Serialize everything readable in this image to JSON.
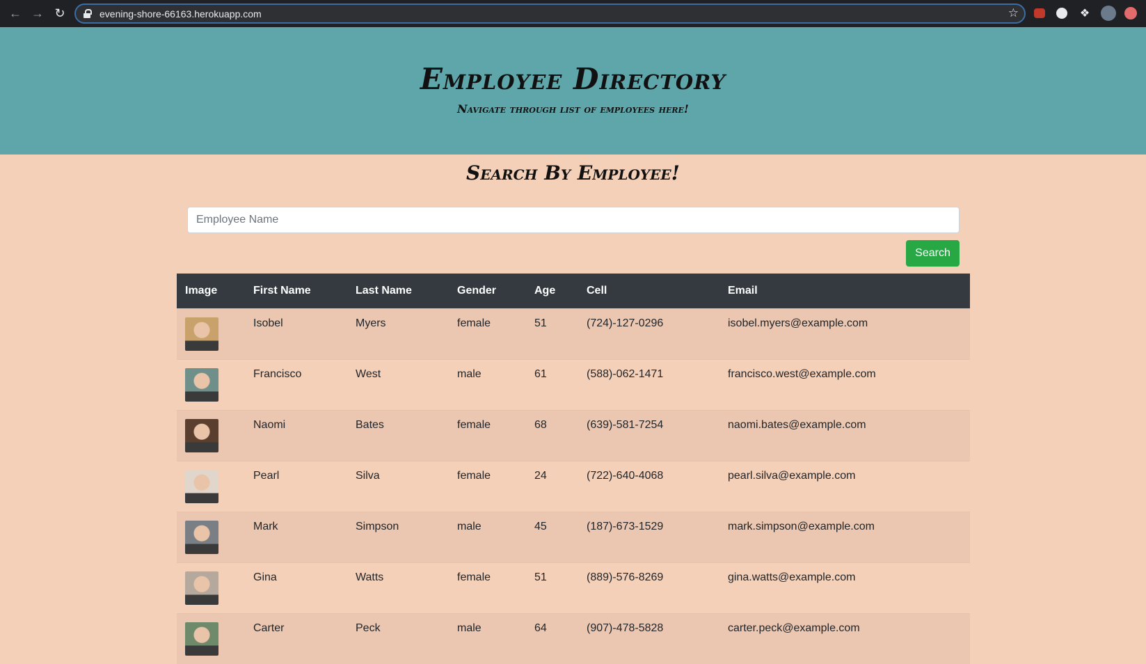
{
  "browser": {
    "url": "evening-shore-66163.herokuapp.com",
    "nav_back_icon": "arrow-left-icon",
    "nav_forward_icon": "arrow-right-icon",
    "reload_icon": "reload-icon",
    "star_icon": "star-icon"
  },
  "header": {
    "title": "Employee Directory",
    "subtitle": "Navigate through list of employees here!"
  },
  "search": {
    "heading": "Search By Employee!",
    "placeholder": "Employee Name",
    "value": "",
    "button_label": "Search"
  },
  "table": {
    "columns": [
      "Image",
      "First Name",
      "Last Name",
      "Gender",
      "Age",
      "Cell",
      "Email"
    ],
    "rows": [
      {
        "first": "Isobel",
        "last": "Myers",
        "gender": "female",
        "age": "51",
        "cell": "(724)-127-0296",
        "email": "isobel.myers@example.com",
        "avatar_color": "#c9a16a"
      },
      {
        "first": "Francisco",
        "last": "West",
        "gender": "male",
        "age": "61",
        "cell": "(588)-062-1471",
        "email": "francisco.west@example.com",
        "avatar_color": "#6f8f8a"
      },
      {
        "first": "Naomi",
        "last": "Bates",
        "gender": "female",
        "age": "68",
        "cell": "(639)-581-7254",
        "email": "naomi.bates@example.com",
        "avatar_color": "#5a3f2e"
      },
      {
        "first": "Pearl",
        "last": "Silva",
        "gender": "female",
        "age": "24",
        "cell": "(722)-640-4068",
        "email": "pearl.silva@example.com",
        "avatar_color": "#e0d6cc"
      },
      {
        "first": "Mark",
        "last": "Simpson",
        "gender": "male",
        "age": "45",
        "cell": "(187)-673-1529",
        "email": "mark.simpson@example.com",
        "avatar_color": "#7a7f86"
      },
      {
        "first": "Gina",
        "last": "Watts",
        "gender": "female",
        "age": "51",
        "cell": "(889)-576-8269",
        "email": "gina.watts@example.com",
        "avatar_color": "#b5a99e"
      },
      {
        "first": "Carter",
        "last": "Peck",
        "gender": "male",
        "age": "64",
        "cell": "(907)-478-5828",
        "email": "carter.peck@example.com",
        "avatar_color": "#6e8a6a"
      }
    ]
  }
}
